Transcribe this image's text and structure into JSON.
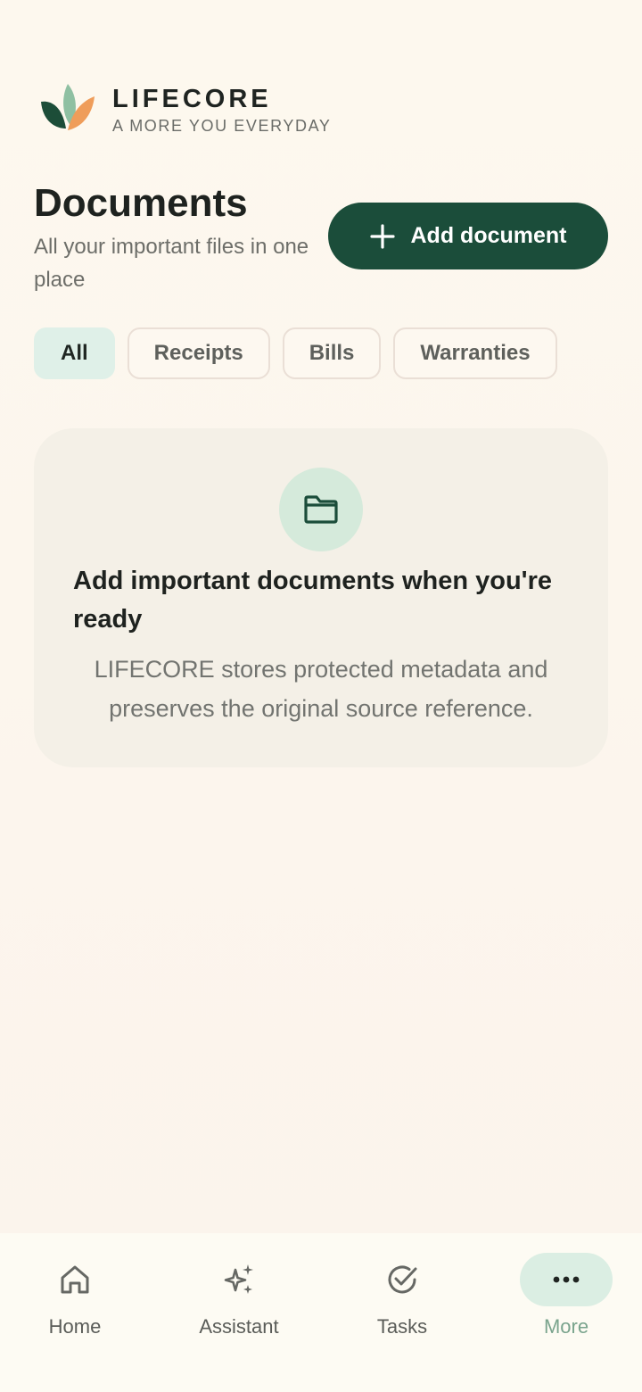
{
  "brand": {
    "name": "LIFECORE",
    "tagline": "A MORE YOU EVERYDAY"
  },
  "header": {
    "title": "Documents",
    "subtitle": "All your important files in one place",
    "add_button_label": "Add document"
  },
  "filters": [
    {
      "label": "All",
      "active": true
    },
    {
      "label": "Receipts",
      "active": false
    },
    {
      "label": "Bills",
      "active": false
    },
    {
      "label": "Warranties",
      "active": false
    }
  ],
  "empty_state": {
    "icon": "folder-icon",
    "title": "Add important documents when you're ready",
    "text": "LIFECORE stores protected metadata and preserves the original source reference."
  },
  "nav": {
    "items": [
      {
        "label": "Home",
        "icon": "home-icon",
        "active": false
      },
      {
        "label": "Assistant",
        "icon": "sparkles-icon",
        "active": false
      },
      {
        "label": "Tasks",
        "icon": "check-circle-icon",
        "active": false
      },
      {
        "label": "More",
        "icon": "more-dots-icon",
        "active": true
      }
    ]
  },
  "colors": {
    "primary": "#1b4d3a",
    "active_chip": "#dff0e8",
    "active_nav_label": "#7aa48d",
    "background": "#fdf8ee"
  }
}
